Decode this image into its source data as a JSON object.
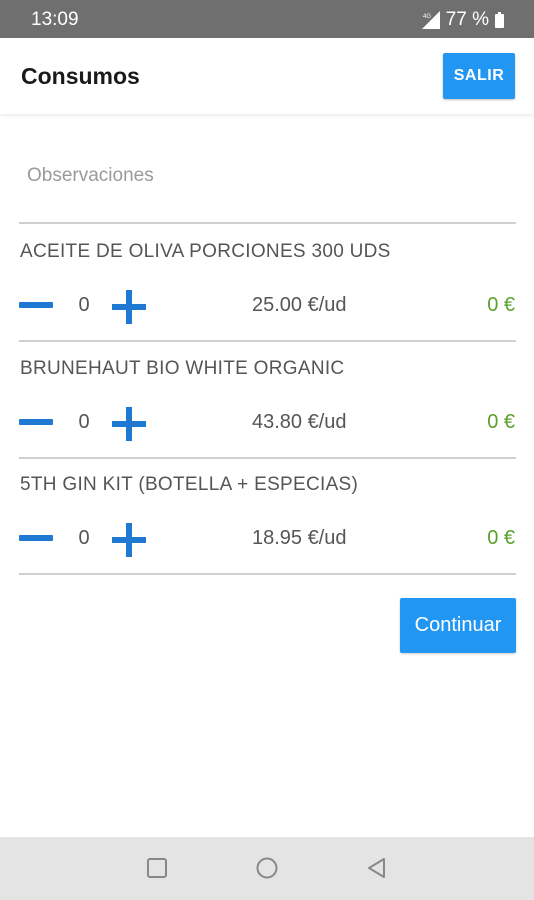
{
  "status_bar": {
    "time": "13:09",
    "network_icon": "signal-icon",
    "battery": "77 %",
    "battery_icon": "battery-icon"
  },
  "app_bar": {
    "title": "Consumos",
    "exit_label": "SALIR"
  },
  "observations": {
    "placeholder": "Observaciones",
    "value": ""
  },
  "products": [
    {
      "name": "ACEITE DE OLIVA PORCIONES 300 UDS",
      "quantity": "0",
      "price": "25.00 €/ud",
      "total": "0 €"
    },
    {
      "name": "BRUNEHAUT BIO WHITE ORGANIC",
      "quantity": "0",
      "price": "43.80 €/ud",
      "total": "0 €"
    },
    {
      "name": "5TH GIN KIT (BOTELLA + ESPECIAS)",
      "quantity": "0",
      "price": "18.95 €/ud",
      "total": "0 €"
    }
  ],
  "continue_label": "Continuar",
  "nav_bar": {
    "recents_icon": "square-icon",
    "home_icon": "circle-icon",
    "back_icon": "triangle-back-icon"
  },
  "colors": {
    "accent": "#2196f3",
    "stepper": "#1f78d1",
    "total_green": "#5aa02c",
    "status_bar": "#6f6f6f"
  }
}
